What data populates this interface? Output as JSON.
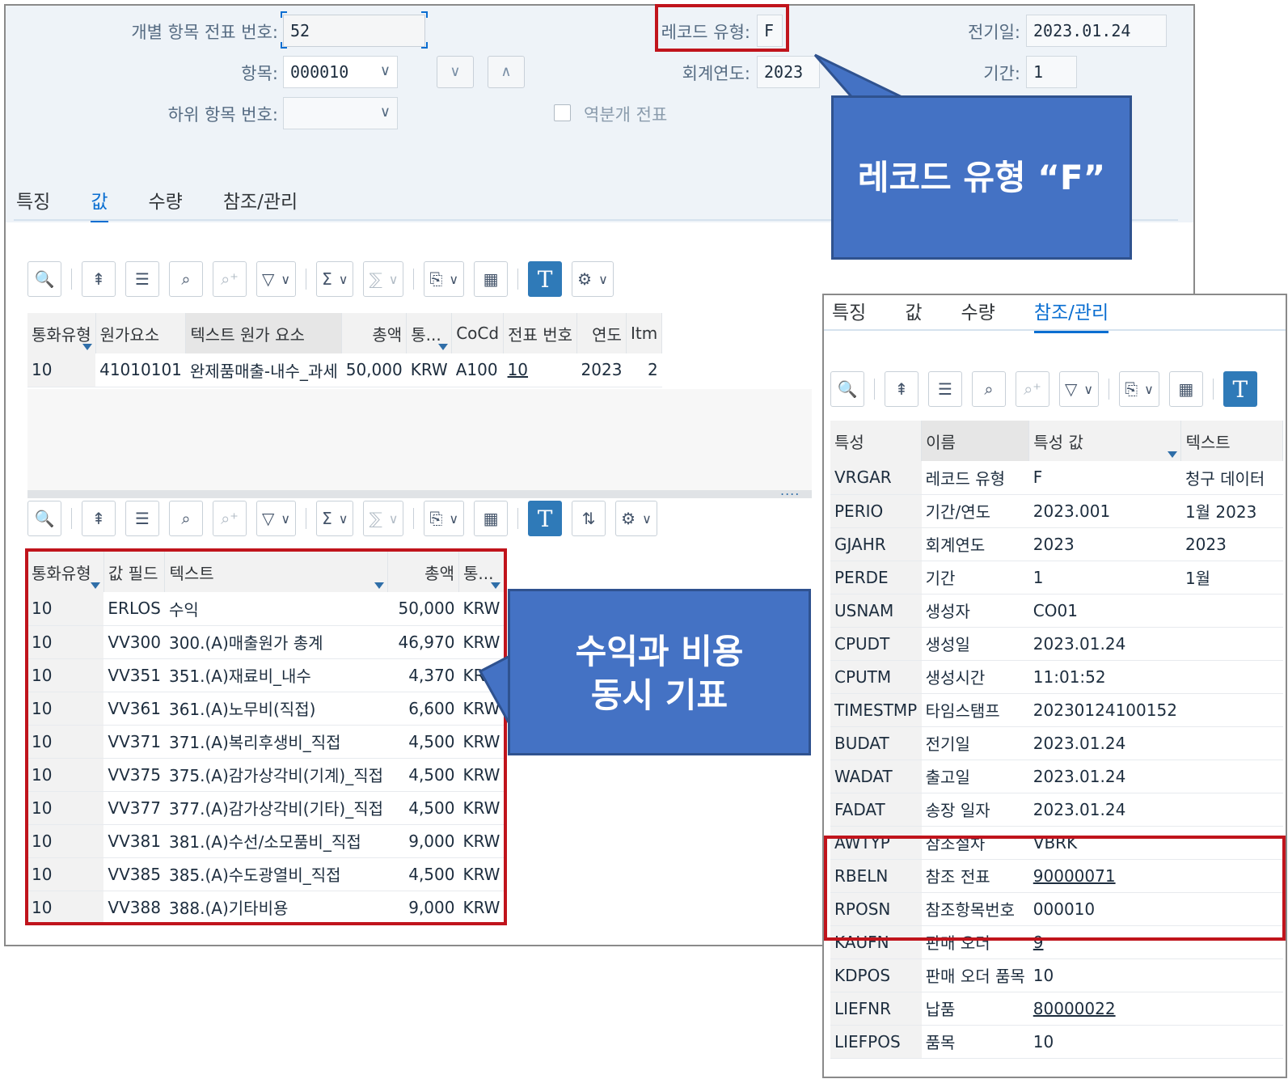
{
  "header": {
    "doc_no_label": "개별 항목 전표 번호:",
    "doc_no": "52",
    "item_label": "항목:",
    "item": "000010",
    "sub_item_label": "하위 항목 번호:",
    "sub_item": "",
    "record_type_label": "레코드 유형:",
    "record_type": "F",
    "fiscal_year_label": "회계연도:",
    "fiscal_year": "2023",
    "reversal_label": "역분개 전표",
    "posting_date_label": "전기일:",
    "posting_date": "2023.01.24",
    "period_label": "기간:",
    "period": "1",
    "down_glyph": "∨",
    "up_glyph": "∧",
    "chev": "∨"
  },
  "tabs": [
    "특징",
    "값",
    "수량",
    "참조/관리"
  ],
  "toolbar": {
    "zoom": "🔍",
    "top": "⇞",
    "filter_lines": "☰",
    "search": "⌕",
    "search_plus": "⌕⁺",
    "funnel": "▽",
    "sigma": "Σ",
    "subtotal": "⅀",
    "export": "⎘",
    "grid": "▦",
    "t": "T",
    "settings": "⚙",
    "dd": "∨",
    "swap": "⇅"
  },
  "top_table": {
    "headers": [
      "통화유형",
      "원가요소",
      "텍스트 원가 요소",
      "총액",
      "통...",
      "CoCd",
      "전표 번호",
      "연도",
      "Itm"
    ],
    "rows": [
      [
        "10",
        "41010101",
        "완제품매출-내수_과세",
        "50,000",
        "KRW",
        "A100",
        "10",
        "2023",
        "2"
      ]
    ]
  },
  "value_table": {
    "headers": [
      "통화유형",
      "값 필드",
      "텍스트",
      "총액",
      "통..."
    ],
    "rows": [
      [
        "10",
        "ERLOS",
        "수익",
        "50,000",
        "KRW"
      ],
      [
        "10",
        "VV300",
        "300.(A)매출원가 총계",
        "46,970",
        "KRW"
      ],
      [
        "10",
        "VV351",
        "351.(A)재료비_내수",
        "4,370",
        "KRW"
      ],
      [
        "10",
        "VV361",
        "361.(A)노무비(직접)",
        "6,600",
        "KRW"
      ],
      [
        "10",
        "VV371",
        "371.(A)복리후생비_직접",
        "4,500",
        "KRW"
      ],
      [
        "10",
        "VV375",
        "375.(A)감가상각비(기계)_직접",
        "4,500",
        "KRW"
      ],
      [
        "10",
        "VV377",
        "377.(A)감가상각비(기타)_직접",
        "4,500",
        "KRW"
      ],
      [
        "10",
        "VV381",
        "381.(A)수선/소모품비_직접",
        "9,000",
        "KRW"
      ],
      [
        "10",
        "VV385",
        "385.(A)수도광열비_직접",
        "4,500",
        "KRW"
      ],
      [
        "10",
        "VV388",
        "388.(A)기타비용",
        "9,000",
        "KRW"
      ]
    ]
  },
  "side_table": {
    "headers": [
      "특성",
      "이름",
      "특성 값",
      "텍스트"
    ],
    "rows": [
      [
        "VRGAR",
        "레코드 유형",
        "F",
        "청구 데이터"
      ],
      [
        "PERIO",
        "기간/연도",
        "2023.001",
        "1월 2023"
      ],
      [
        "GJAHR",
        "회계연도",
        "2023",
        "2023"
      ],
      [
        "PERDE",
        "기간",
        "1",
        "1월"
      ],
      [
        "USNAM",
        "생성자",
        "CO01",
        ""
      ],
      [
        "CPUDT",
        "생성일",
        "2023.01.24",
        ""
      ],
      [
        "CPUTM",
        "생성시간",
        "11:01:52",
        ""
      ],
      [
        "TIMESTMP",
        "타임스탬프",
        "20230124100152",
        ""
      ],
      [
        "BUDAT",
        "전기일",
        "2023.01.24",
        ""
      ],
      [
        "WADAT",
        "출고일",
        "2023.01.24",
        ""
      ],
      [
        "FADAT",
        "송장 일자",
        "2023.01.24",
        ""
      ],
      [
        "AWTYP",
        "참조절차",
        "VBRK",
        ""
      ],
      [
        "RBELN",
        "참조 전표",
        "90000071",
        ""
      ],
      [
        "RPOSN",
        "참조항목번호",
        "000010",
        ""
      ],
      [
        "KAUFN",
        "판매 오더",
        "9",
        ""
      ],
      [
        "KDPOS",
        "판매 오더 품목",
        "10",
        ""
      ],
      [
        "LIEFNR",
        "납품",
        "80000022",
        ""
      ],
      [
        "LIEFPOS",
        "품목",
        "10",
        ""
      ]
    ]
  },
  "splitter_dots": "....",
  "callouts": {
    "record_type": "레코드 유형 “F”",
    "revenue_cost_line1": "수익과 비용",
    "revenue_cost_line2": "동시 기표"
  }
}
